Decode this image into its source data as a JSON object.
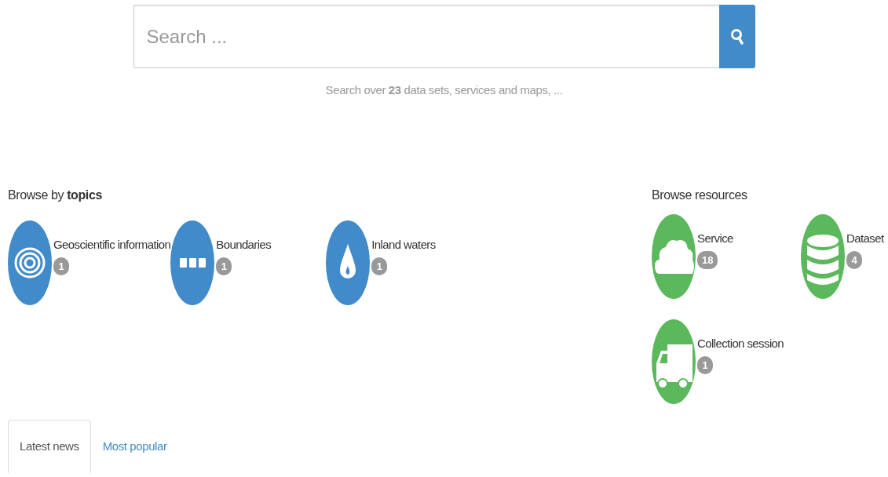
{
  "search": {
    "placeholder": "Search ...",
    "hint": "Search over **23** data sets, services and maps, ..."
  },
  "topics": {
    "heading": "Browse by **topics**",
    "items": [
      {
        "label": "Geoscientific information",
        "count": "1"
      },
      {
        "label": "Boundaries",
        "count": "1"
      },
      {
        "label": "Inland waters",
        "count": "1"
      }
    ]
  },
  "resources": {
    "heading": "Browse resources",
    "items": [
      {
        "label": "Service",
        "count": "18"
      },
      {
        "label": "Dataset",
        "count": "4"
      },
      {
        "label": "Collection session",
        "count": "1"
      }
    ]
  },
  "tabs": [
    {
      "label": "Latest news",
      "selected": true
    },
    {
      "label": "Most popular",
      "selected": false
    }
  ]
}
